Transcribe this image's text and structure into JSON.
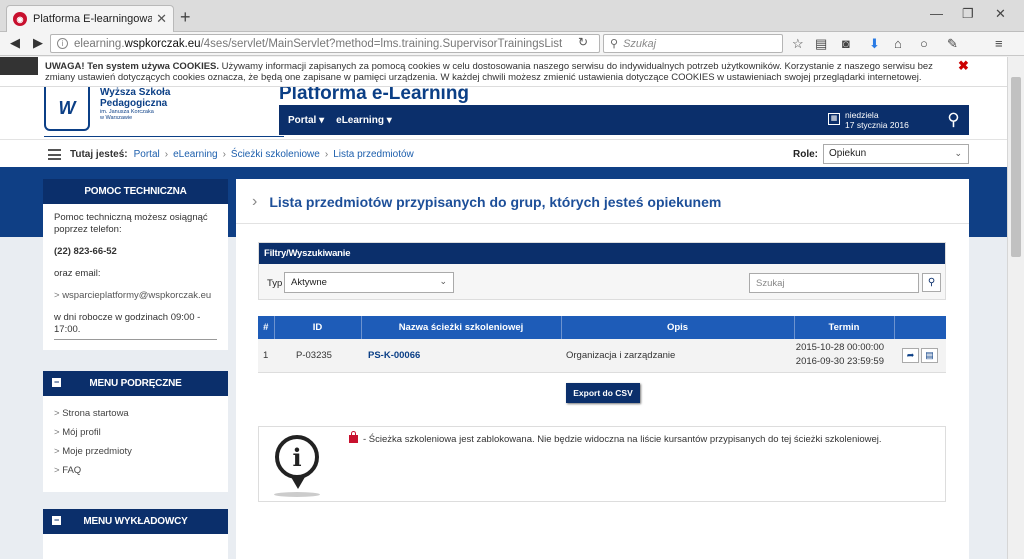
{
  "browser": {
    "tab_title": "Platforma E-learningowa ...",
    "url_prefix": "elearning.",
    "url_domain": "wspkorczak.eu",
    "url_path": "/4ses/servlet/MainServlet?method=lms.training.SupervisorTrainingsList",
    "search_placeholder": "Szukaj"
  },
  "cookie": {
    "bold": "UWAGA! Ten system używa COOKIES.",
    "text": " Używamy informacji zapisanych za pomocą cookies w celu dostosowania naszego serwisu do indywidualnych potrzeb użytkowników. Korzystanie z naszego serwisu bez zmiany ustawień dotyczących cookies oznacza, że będą one zapisane w pamięci urządzenia. W każdej chwili możesz zmienić ustawienia dotyczące COOKIES w ustawieniach swojej przeglądarki internetowej."
  },
  "header": {
    "logo_mark": "W",
    "logo_line1": "Wyższa Szkoła",
    "logo_line2": "Pedagogiczna",
    "logo_line3": "im. Janusza Korczaka",
    "logo_line4": "w Warszawie",
    "platform_title": "Platforma e-Learning",
    "menu": [
      "Portal ▾",
      "eLearning ▾"
    ],
    "date_day": "niedziela",
    "date_full": "17 stycznia 2016"
  },
  "breadcrumb": {
    "label": "Tutaj jesteś:",
    "items": [
      "Portal",
      "eLearning",
      "Ścieżki szkoleniowe",
      "Lista przedmiotów"
    ]
  },
  "role": {
    "label": "Role:",
    "value": "Opiekun"
  },
  "sidebar": {
    "help_title": "POMOC TECHNICZNA",
    "help_text1": "Pomoc techniczną możesz osiągnąć poprzez telefon:",
    "help_phone": "(22) 823-66-52",
    "help_text2": "oraz email:",
    "help_email": "wsparcieplatformy@wspkorczak.eu",
    "help_hours": "w dni robocze w godzinach 09:00 - 17:00.",
    "menu_title": "MENU PODRĘCZNE",
    "menu_items": [
      "Strona startowa",
      "Mój profil",
      "Moje przedmioty",
      "FAQ"
    ],
    "lecturer_title": "MENU WYKŁADOWCY"
  },
  "main": {
    "title": "Lista przedmiotów przypisanych do grup, których jesteś opiekunem",
    "filter_title": "Filtry/Wyszukiwanie",
    "type_label": "Typ",
    "type_value": "Aktywne",
    "search_placeholder": "Szukaj",
    "columns": [
      "#",
      "ID",
      "Nazwa ścieżki szkoleniowej",
      "Opis",
      "Termin"
    ],
    "rows": [
      {
        "num": "1",
        "id": "P-03235",
        "name": "PS-K-00066",
        "desc": "Organizacja i zarządzanie",
        "date_from": "2015-10-28 00:00:00",
        "date_to": "2016-09-30 23:59:59"
      }
    ],
    "export_label": "Export do CSV",
    "info_text": " - Ścieżka szkoleniowa jest zablokowana. Nie będzie widoczna na liście kursantów przypisanych do tej ścieżki szkoleniowej."
  }
}
